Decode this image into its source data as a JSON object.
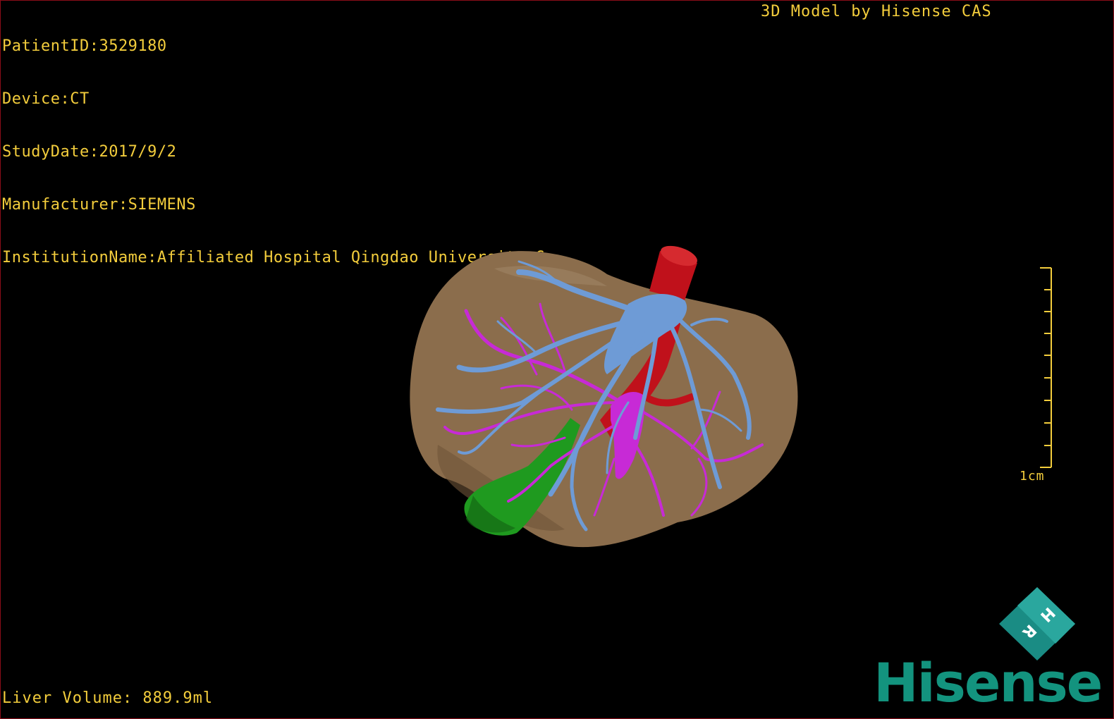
{
  "overlay": {
    "patient_id": "PatientID:3529180",
    "device": "Device:CT",
    "study_date": "StudyDate:2017/9/2",
    "manufacturer": "Manufacturer:SIEMENS",
    "institution": "InstitutionName:Affiliated Hospital Qingdao University-C",
    "credit": "3D Model by Hisense CAS",
    "liver_volume": "Liver Volume: 889.9ml"
  },
  "scale": {
    "label": "1cm"
  },
  "orientation_cube": {
    "letters": [
      "H",
      "R"
    ]
  },
  "brand": {
    "name": "Hisense"
  },
  "colors": {
    "overlay_text": "#f3cd3c",
    "liver": "#8b6d4c",
    "hepatic_vein": "#6e9bd6",
    "portal_vein": "#c72ad6",
    "artery": "#c0111b",
    "biliary": "#1f9a1f",
    "brand": "#13937e",
    "viewport_border": "#8b0d18"
  }
}
